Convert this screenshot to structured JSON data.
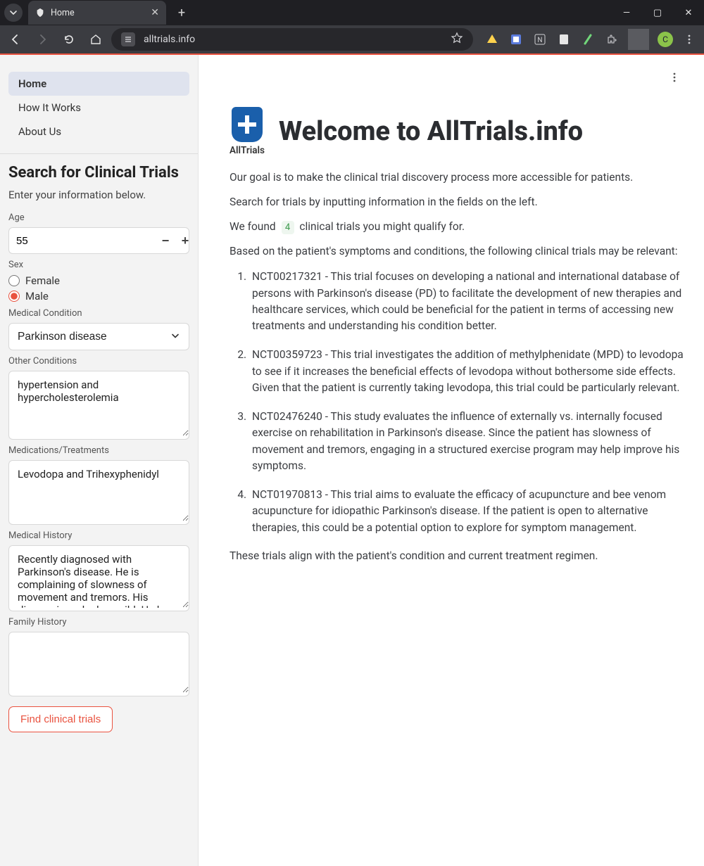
{
  "browser": {
    "tab_title": "Home",
    "url": "alltrials.info",
    "avatar_letter": "C"
  },
  "sidebar": {
    "nav": [
      {
        "label": "Home",
        "active": true
      },
      {
        "label": "How It Works",
        "active": false
      },
      {
        "label": "About Us",
        "active": false
      }
    ],
    "heading": "Search for Clinical Trials",
    "subheading": "Enter your information below.",
    "age_label": "Age",
    "age_value": "55",
    "sex_label": "Sex",
    "sex_options": {
      "female": "Female",
      "male": "Male"
    },
    "sex_selected": "male",
    "condition_label": "Medical Condition",
    "condition_value": "Parkinson disease",
    "other_label": "Other Conditions",
    "other_value": "hypertension and hypercholesterolemia",
    "meds_label": "Medications/Treatments",
    "meds_value": "Levodopa and Trihexyphenidyl",
    "history_label": "Medical History",
    "history_value": "Recently diagnosed with Parkinson's disease. He is complaining of slowness of movement and tremors. His disease is ranked as mild. He has",
    "family_label": "Family History",
    "family_value": "",
    "button_label": "Find clinical trials"
  },
  "main": {
    "logo_text": "AllTrials",
    "title": "Welcome to AllTrials.info",
    "intro1": "Our goal is to make the clinical trial discovery process more accessible for patients.",
    "intro2": "Search for trials by inputting information in the fields on the left.",
    "found_prefix": "We found",
    "found_count": "4",
    "found_suffix": "clinical trials you might qualify for.",
    "relevance_line": "Based on the patient's symptoms and conditions, the following clinical trials may be relevant:",
    "results": [
      "NCT00217321 - This trial focuses on developing a national and international database of persons with Parkinson's disease (PD) to facilitate the development of new therapies and healthcare services, which could be beneficial for the patient in terms of accessing new treatments and understanding his condition better.",
      "NCT00359723 - This trial investigates the addition of methylphenidate (MPD) to levodopa to see if it increases the beneficial effects of levodopa without bothersome side effects. Given that the patient is currently taking levodopa, this trial could be particularly relevant.",
      "NCT02476240 - This study evaluates the influence of externally vs. internally focused exercise on rehabilitation in Parkinson's disease. Since the patient has slowness of movement and tremors, engaging in a structured exercise program may help improve his symptoms.",
      "NCT01970813 - This trial aims to evaluate the efficacy of acupuncture and bee venom acupuncture for idiopathic Parkinson's disease. If the patient is open to alternative therapies, this could be a potential option to explore for symptom management."
    ],
    "closing": "These trials align with the patient's condition and current treatment regimen."
  }
}
